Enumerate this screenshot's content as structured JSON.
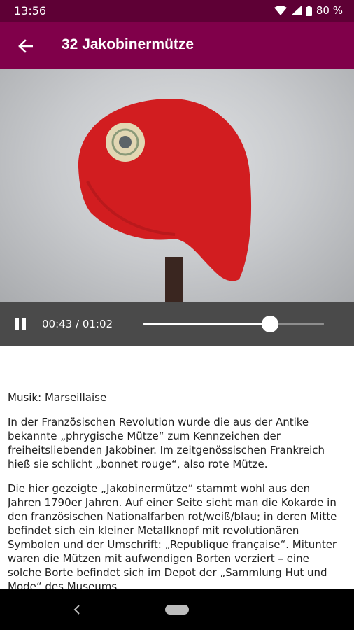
{
  "status": {
    "time": "13:56",
    "battery": "80 %"
  },
  "header": {
    "title": "32 Jakobinermütze"
  },
  "player": {
    "time": "00:43 / 01:02",
    "progress": 0.7
  },
  "content": {
    "paragraphs": [
      "Musik: Marseillaise",
      "In der Französischen Revolution wurde die aus der Antike bekannte „phrygische Mütze“ zum Kennzeichen der freiheitsliebenden Jakobiner. Im zeitgenössischen Frankreich hieß sie schlicht „bonnet rouge“, also rote Mütze.",
      "Die hier gezeigte „Jakobinermütze“ stammt wohl aus den Jahren 1790er Jahren. Auf einer Seite sieht man die Kokarde in den französischen Nationalfarben rot/weiß/blau; in deren Mitte befindet sich ein kleiner Metallknopf mit revolutionären Symbolen und der Umschrift: „Republique française“. Mitunter waren die Mützen mit aufwendigen Borten verziert – eine solche Borte befindet sich im Depot der „Sammlung Hut und Mode“ des Museums."
    ]
  },
  "colors": {
    "status_bar": "#5e0035",
    "app_bar": "#80004a",
    "player_bg": "#4a4a4a",
    "cap_red": "#d21d20"
  }
}
